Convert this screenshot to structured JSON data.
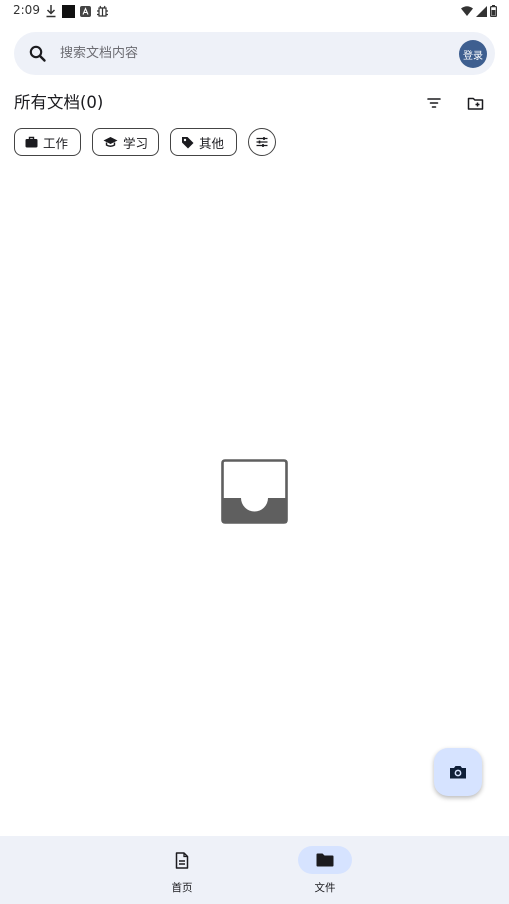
{
  "status_bar": {
    "time": "2:09",
    "left_icons": [
      "download-icon",
      "square-icon",
      "a-icon",
      "bug-icon"
    ],
    "right_icons": [
      "wifi-icon",
      "signal-icon",
      "battery-icon"
    ]
  },
  "search": {
    "placeholder": "搜索文档内容",
    "value": "",
    "login_label": "登录"
  },
  "section": {
    "title": "所有文档(0)",
    "actions": [
      "filter-icon",
      "new-folder-icon"
    ]
  },
  "chips": [
    {
      "label": "工作",
      "icon": "briefcase-icon"
    },
    {
      "label": "学习",
      "icon": "graduation-cap-icon"
    },
    {
      "label": "其他",
      "icon": "tag-icon"
    }
  ],
  "chip_settings_icon": "tune-icon",
  "empty_state": {
    "icon": "inbox-icon"
  },
  "fab": {
    "icon": "camera-icon"
  },
  "bottom_nav": {
    "items": [
      {
        "label": "首页",
        "icon": "document-icon",
        "active": false
      },
      {
        "label": "文件",
        "icon": "folder-icon",
        "active": true
      }
    ]
  },
  "colors": {
    "accent": "#3e5f90",
    "surface": "#eef1f8",
    "active_pill": "#d6e3ff",
    "empty_icon": "#5f5f5f"
  }
}
